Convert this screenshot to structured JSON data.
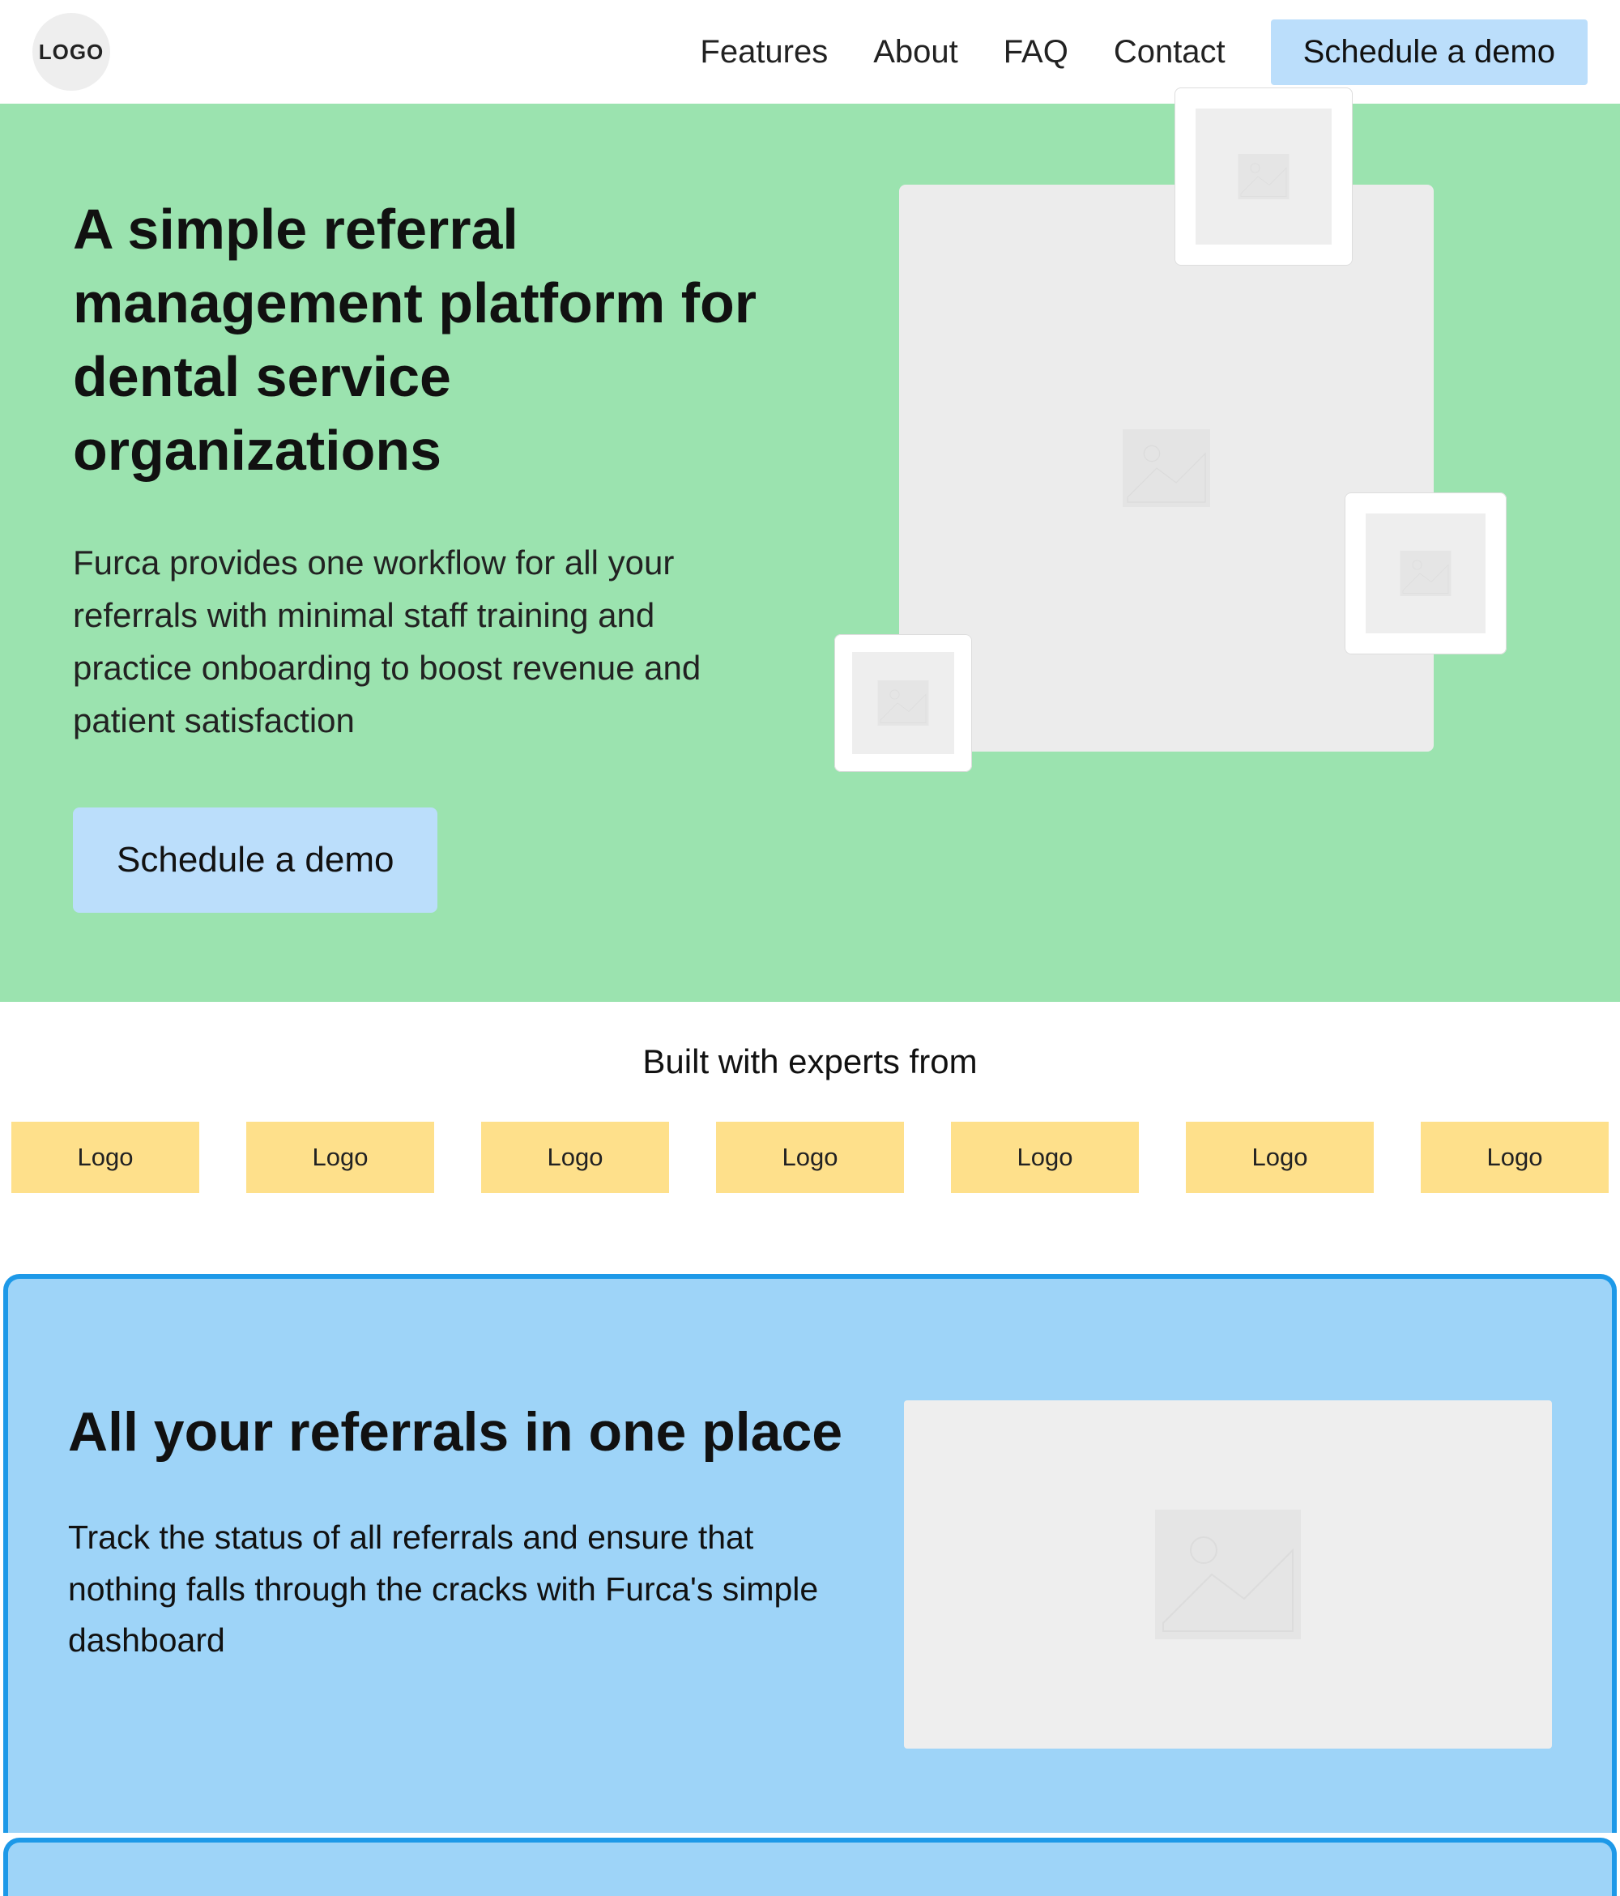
{
  "header": {
    "logo_text": "LOGO",
    "nav": [
      {
        "id": "features",
        "label": "Features"
      },
      {
        "id": "about",
        "label": "About"
      },
      {
        "id": "faq",
        "label": "FAQ"
      },
      {
        "id": "contact",
        "label": "Contact"
      }
    ],
    "cta_label": "Schedule a demo"
  },
  "hero": {
    "title": "A simple referral management platform for dental service organizations",
    "description": "Furca provides one workflow for all your referrals with minimal staff training and practice onboarding to boost revenue and patient satisfaction",
    "cta_label": "Schedule a demo"
  },
  "experts": {
    "title": "Built with experts from",
    "logos": [
      "Logo",
      "Logo",
      "Logo",
      "Logo",
      "Logo",
      "Logo",
      "Logo"
    ]
  },
  "feature1": {
    "title": "All your referrals in one place",
    "description": "Track the status of all referrals and ensure that nothing falls through the cracks with Furca's simple dashboard"
  }
}
